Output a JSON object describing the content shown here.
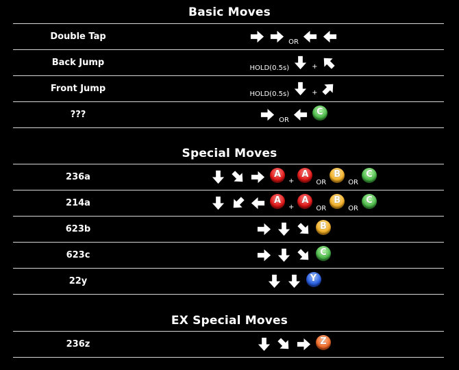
{
  "sections": {
    "basic": {
      "title": "Basic Moves",
      "rows": [
        {
          "name": "Double Tap",
          "joiner_or": "OR"
        },
        {
          "name": "Back Jump",
          "hold": "HOLD(0.5s)",
          "plus": "+"
        },
        {
          "name": "Front Jump",
          "hold": "HOLD(0.5s)",
          "plus": "+"
        },
        {
          "name": "???",
          "joiner_or": "OR"
        }
      ]
    },
    "special": {
      "title": "Special Moves",
      "rows": [
        {
          "name": "236a",
          "plus": "+",
          "or1": "OR",
          "or2": "OR"
        },
        {
          "name": "214a",
          "plus": "+",
          "or1": "OR",
          "or2": "OR"
        },
        {
          "name": "623b"
        },
        {
          "name": "623c"
        },
        {
          "name": "22y"
        }
      ]
    },
    "ex": {
      "title": "EX Special Moves",
      "rows": [
        {
          "name": "236z"
        }
      ]
    }
  },
  "buttons": {
    "a": "A",
    "b": "B",
    "c": "C",
    "y": "Y",
    "z": "Z"
  },
  "colors": {
    "background": "#000000",
    "divider": "#d8d8d8",
    "button_a": "#e01818",
    "button_b": "#f1b02a",
    "button_c": "#4db84a",
    "button_y": "#2a5fe0",
    "button_z": "#f06c2a"
  }
}
